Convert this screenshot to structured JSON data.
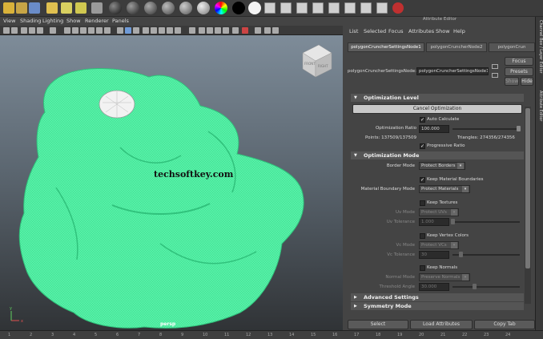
{
  "viewport": {
    "menu": [
      "View",
      "Shading",
      "Lighting",
      "Show",
      "Renderer",
      "Panels"
    ],
    "camera_label": "persp",
    "viewcube_labels": {
      "front": "FRONT",
      "right": "RIGHT"
    },
    "watermark": "techsoftkey.com",
    "axis_labels": {
      "y": "y",
      "x": "x"
    },
    "mesh_color": "#4ef0a0"
  },
  "attribute_editor": {
    "title": "Attribute Editor",
    "menu": [
      "List",
      "Selected",
      "Focus",
      "Attributes",
      "Show",
      "Help"
    ],
    "tabs": [
      "polygonCruncherSettingsNode1",
      "polygonCruncherNode2",
      "polygonCrun"
    ],
    "node_label": "polygonCruncherSettingsNode:",
    "node_value": "polygonCruncherSettingsNode1",
    "side_buttons": {
      "focus": "Focus",
      "presets": "Presets",
      "show": "Show",
      "hide": "Hide"
    },
    "optimization_level": {
      "header": "Optimization Level",
      "cancel_button": "Cancel Optimization",
      "auto_calculate": "Auto Calculate",
      "ratio_label": "Optimization Ratio",
      "ratio_value": "100.000",
      "points": "Points: 137509/137509",
      "triangles": "Triangles: 274356/274356",
      "progressive_ratio": "Progressive Ratio"
    },
    "optimization_mode": {
      "header": "Optimization Mode",
      "border_mode_label": "Border Mode",
      "border_mode_value": "Protect Borders",
      "keep_material_boundaries": "Keep Material Boundaries",
      "material_boundary_label": "Material Boundary Mode",
      "material_boundary_value": "Protect Materials",
      "keep_textures": "Keep Textures",
      "uv_mode_label": "Uv Mode",
      "uv_mode_value": "Protect UVs",
      "uv_tolerance_label": "Uv Tolerance",
      "uv_tolerance_value": "1.000",
      "keep_vertex_colors": "Keep Vertex Colors",
      "vc_mode_label": "Vc Mode",
      "vc_mode_value": "Protect VCs",
      "vc_tolerance_label": "Vc Tolerance",
      "vc_tolerance_value": "30",
      "keep_normals": "Keep Normals",
      "normal_mode_label": "Normal Mode",
      "normal_mode_value": "Preserve Normals",
      "threshold_label": "Threshold Angle",
      "threshold_value": "30.000"
    },
    "advanced_settings": "Advanced Settings",
    "symmetry_mode": "Symmetry Mode",
    "bottom_buttons": [
      "Select",
      "Load Attributes",
      "Copy Tab"
    ]
  },
  "right_sidebar_tabs": [
    "Channel Box / Layer Editor",
    "Attribute Editor"
  ],
  "timeline_ticks": [
    "1",
    "2",
    "3",
    "4",
    "5",
    "6",
    "7",
    "8",
    "9",
    "10",
    "11",
    "12",
    "13",
    "14",
    "15",
    "16",
    "17",
    "18",
    "19",
    "20",
    "21",
    "22",
    "23",
    "24"
  ]
}
